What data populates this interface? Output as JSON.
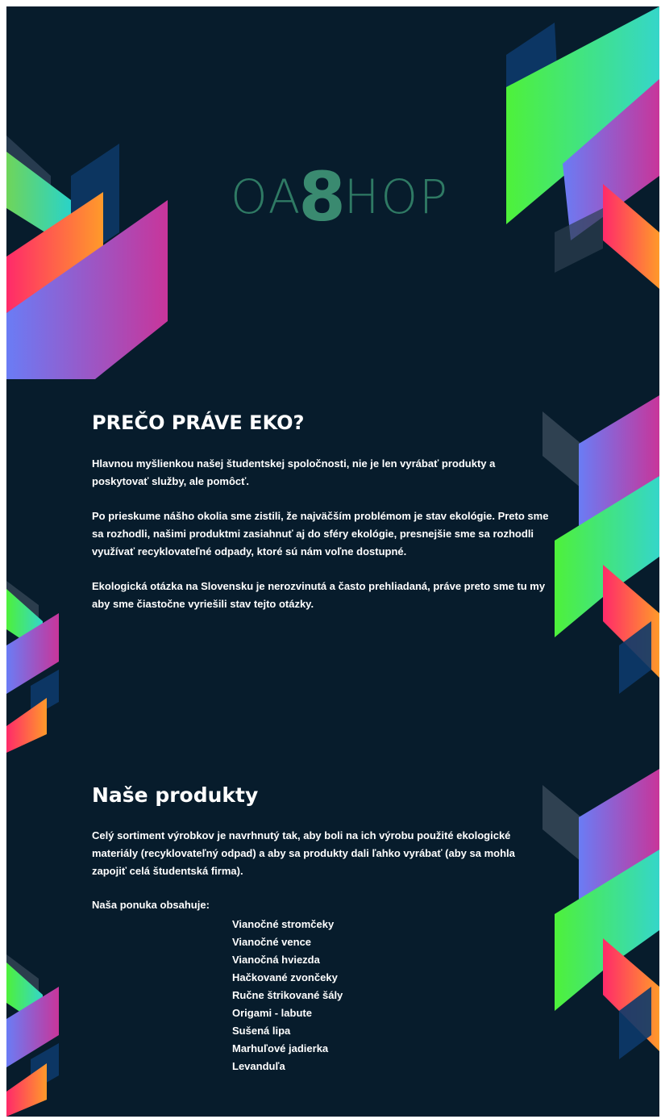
{
  "logo": {
    "text_left": "OA",
    "text_mid": "8",
    "text_right": "HOP",
    "color": "#2f7a64"
  },
  "section_why": {
    "title": "PREČO PRÁVE EKO?",
    "paragraphs": [
      "Hlavnou myšlienkou našej študentskej spoločnosti, nie je len vyrábať produkty a poskytovať služby, ale pomôcť.",
      "Po prieskume nášho okolia sme zistili, že najväčším problémom je stav ekológie. Preto sme sa rozhodli, našimi produktmi zasiahnuť aj do sféry ekológie, presnejšie sme sa rozhodli využívať recyklovateľné odpady, ktoré sú nám voľne dostupné.",
      "Ekologická otázka na Slovensku je nerozvinutá a často prehliadaná, práve preto sme tu my aby sme čiastočne vyriešili stav tejto otázky."
    ]
  },
  "section_products": {
    "title": "Naše produkty",
    "intro": "Celý sortiment výrobkov je navrhnutý tak, aby boli na ich výrobu použité ekologické materiály (recyklovateľný odpad) a aby sa produkty dali ľahko vyrábať (aby sa mohla zapojiť celá študentská firma).",
    "offer_label": "Naša ponuka obsahuje:",
    "items": [
      "Vianočné stromčeky",
      "Vianočné vence",
      "Vianočná hviezda",
      "Hačkované zvončeky",
      "Ručne štrikované šály",
      "Origami - labute",
      "Sušená lipa",
      "Marhuľové jadierka",
      "Levanduľa"
    ]
  },
  "colors": {
    "background": "#071c2c",
    "green": "#4ef13a",
    "teal": "#2ad3c8",
    "magenta": "#c8359a",
    "blue": "#6a7cf5",
    "orange": "#ff8a2a",
    "pink": "#ff2a6a",
    "navy_shape": "#0d3a6a"
  }
}
